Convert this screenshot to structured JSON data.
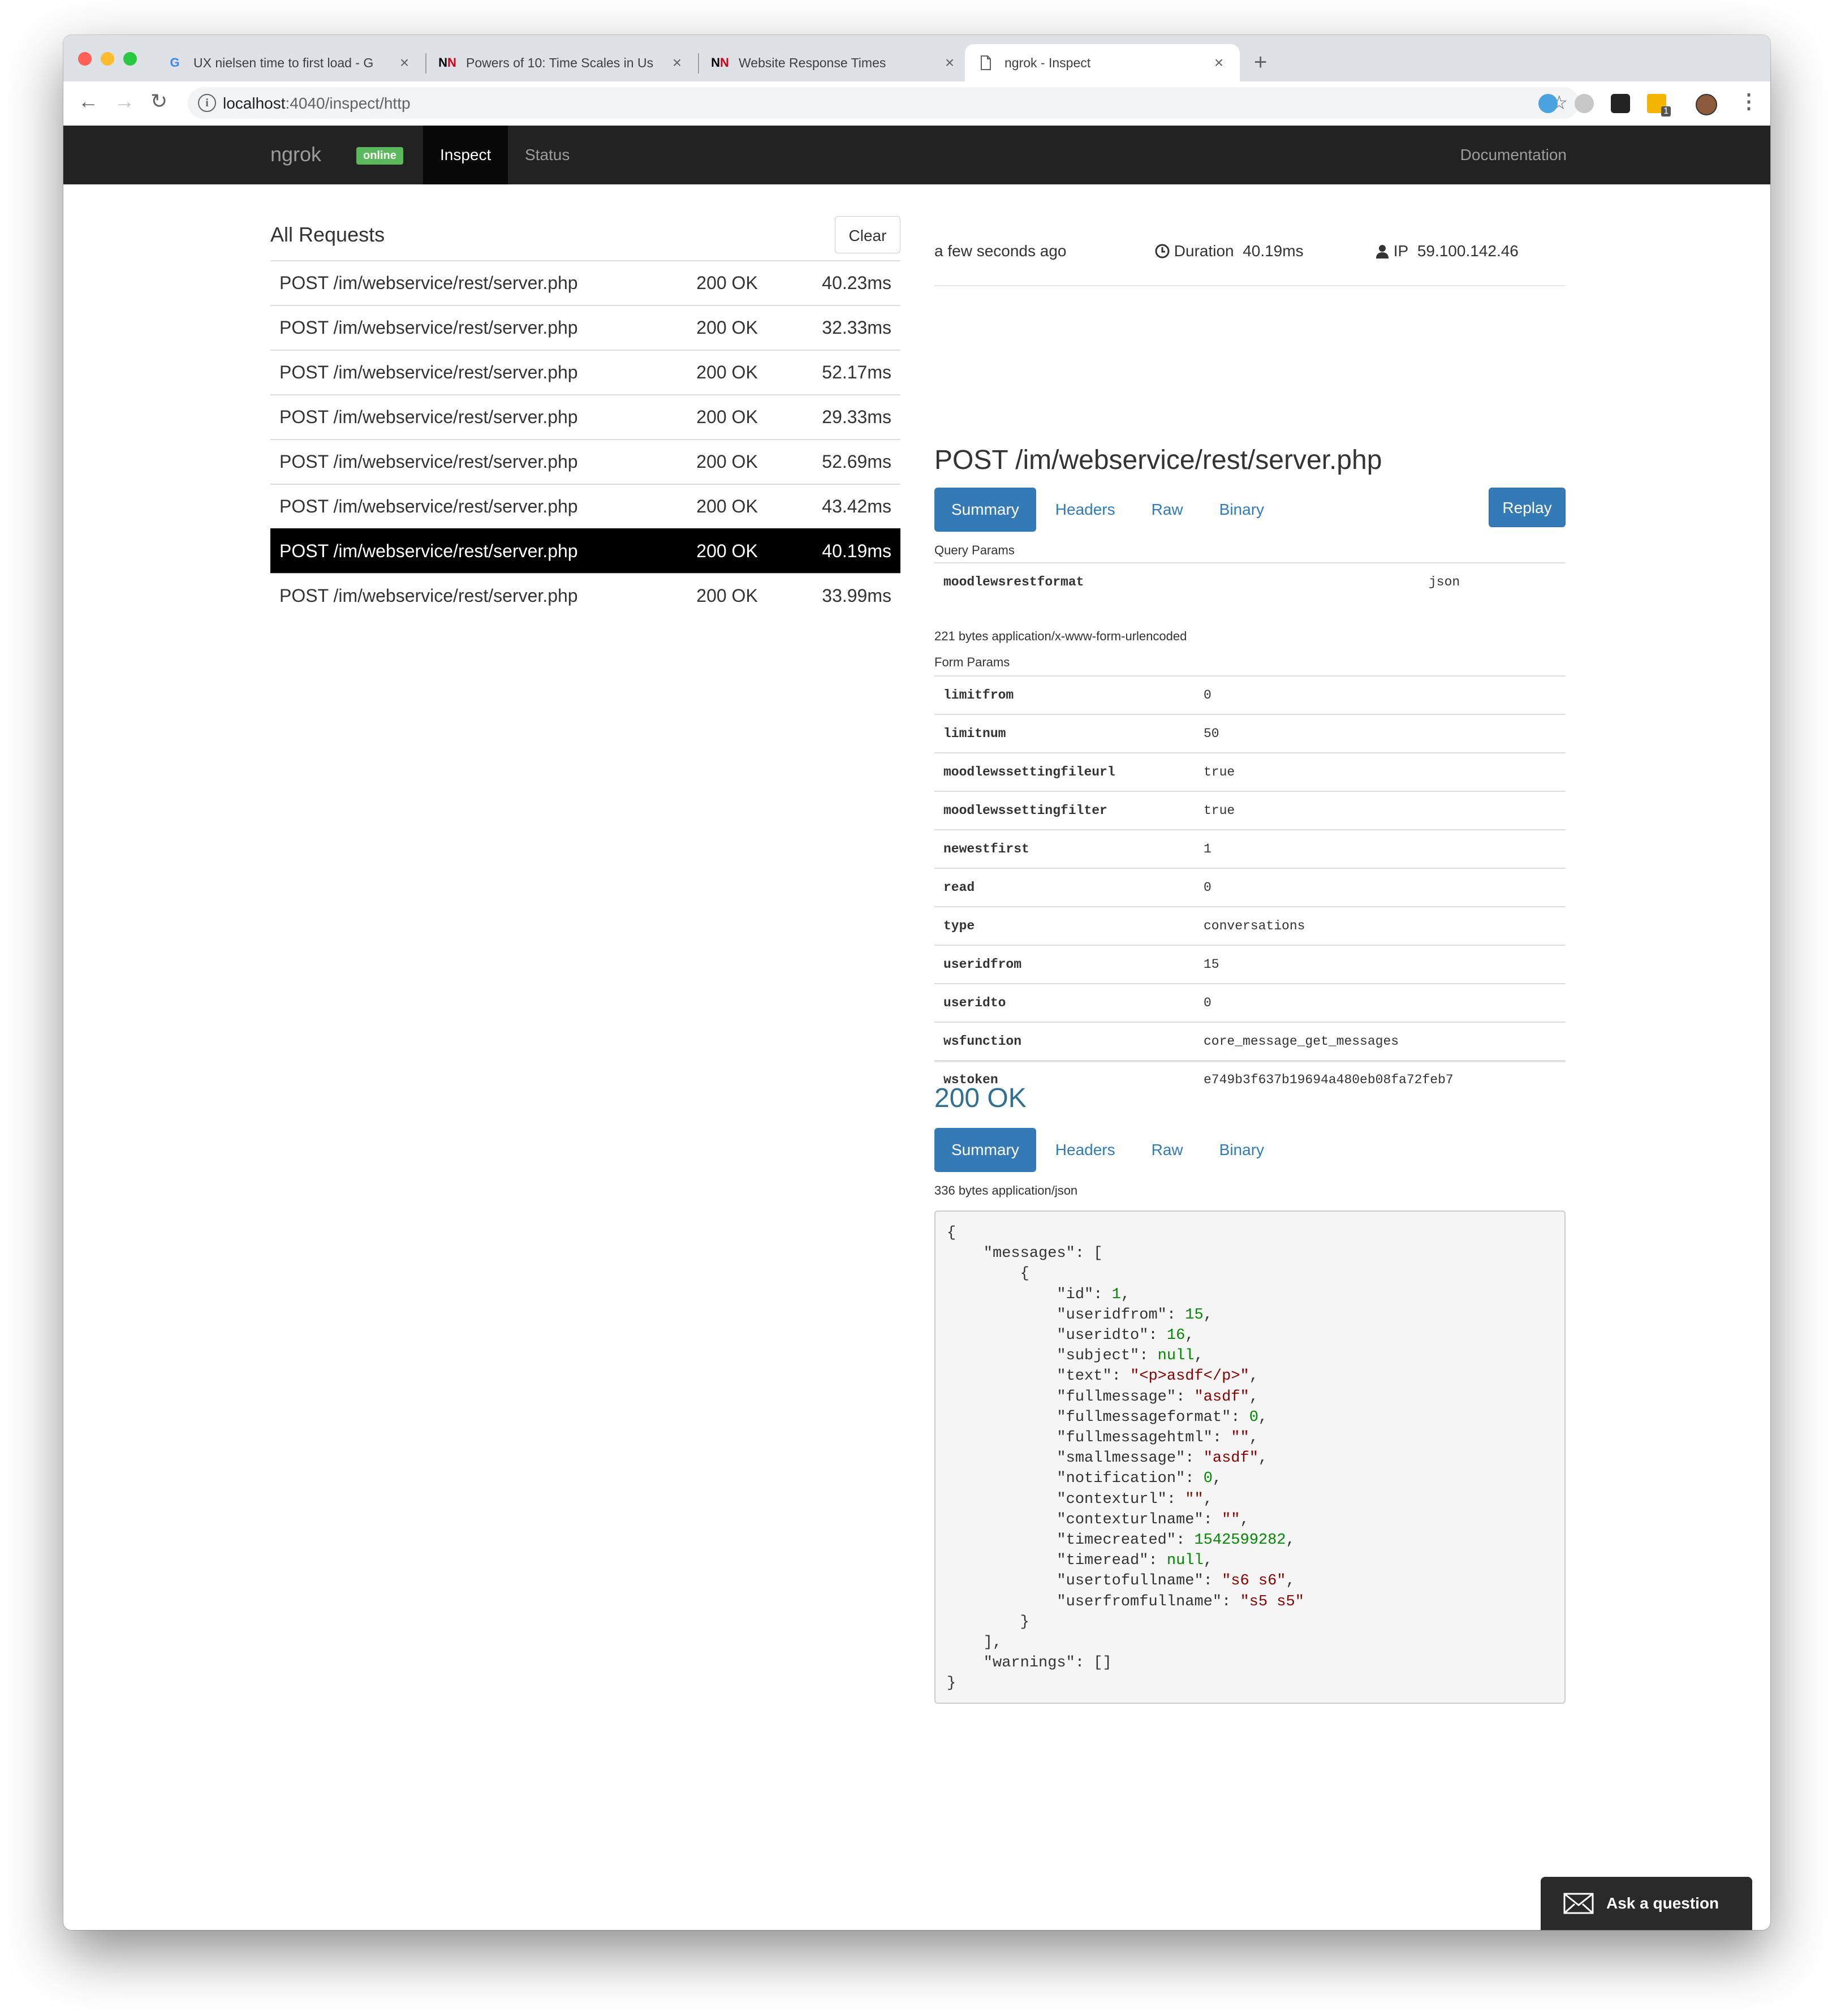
{
  "browser": {
    "tabs": [
      {
        "title": "UX nielsen time to first load - G",
        "favicon": "google-icon"
      },
      {
        "title": "Powers of 10: Time Scales in Us",
        "favicon": "nn-icon"
      },
      {
        "title": "Website Response Times",
        "favicon": "nn-icon"
      },
      {
        "title": "ngrok - Inspect",
        "favicon": "document-icon"
      }
    ],
    "url_host": "localhost",
    "url_path": ":4040/inspect/http",
    "extension_badge": "1"
  },
  "nav": {
    "brand": "ngrok",
    "status_badge": "online",
    "links": [
      "Inspect",
      "Status"
    ],
    "documentation": "Documentation"
  },
  "requests": {
    "heading": "All Requests",
    "clear_label": "Clear",
    "rows": [
      {
        "path": "POST /im/webservice/rest/server.php",
        "status": "200 OK",
        "duration": "40.23ms"
      },
      {
        "path": "POST /im/webservice/rest/server.php",
        "status": "200 OK",
        "duration": "32.33ms"
      },
      {
        "path": "POST /im/webservice/rest/server.php",
        "status": "200 OK",
        "duration": "52.17ms"
      },
      {
        "path": "POST /im/webservice/rest/server.php",
        "status": "200 OK",
        "duration": "29.33ms"
      },
      {
        "path": "POST /im/webservice/rest/server.php",
        "status": "200 OK",
        "duration": "52.69ms"
      },
      {
        "path": "POST /im/webservice/rest/server.php",
        "status": "200 OK",
        "duration": "43.42ms"
      },
      {
        "path": "POST /im/webservice/rest/server.php",
        "status": "200 OK",
        "duration": "40.19ms"
      },
      {
        "path": "POST /im/webservice/rest/server.php",
        "status": "200 OK",
        "duration": "33.99ms"
      }
    ]
  },
  "detail": {
    "time": "a few seconds ago",
    "duration_label": "Duration",
    "duration": "40.19ms",
    "ip_label": "IP",
    "ip": "59.100.142.46",
    "title": "POST /im/webservice/rest/server.php",
    "tabs": [
      "Summary",
      "Headers",
      "Raw",
      "Binary"
    ],
    "replay_label": "Replay",
    "query_params_label": "Query Params",
    "query_params": [
      {
        "key": "moodlewsrestformat",
        "value": "json"
      }
    ],
    "body_info": "221 bytes application/x-www-form-urlencoded",
    "form_params_label": "Form Params",
    "form_params": [
      {
        "key": "limitfrom",
        "value": "0"
      },
      {
        "key": "limitnum",
        "value": "50"
      },
      {
        "key": "moodlewssettingfileurl",
        "value": "true"
      },
      {
        "key": "moodlewssettingfilter",
        "value": "true"
      },
      {
        "key": "newestfirst",
        "value": "1"
      },
      {
        "key": "read",
        "value": "0"
      },
      {
        "key": "type",
        "value": "conversations"
      },
      {
        "key": "useridfrom",
        "value": "15"
      },
      {
        "key": "useridto",
        "value": "0"
      },
      {
        "key": "wsfunction",
        "value": "core_message_get_messages"
      },
      {
        "key": "wstoken",
        "value": "e749b3f637b19694a480eb08fa72feb7"
      }
    ]
  },
  "response": {
    "status": "200 OK",
    "tabs": [
      "Summary",
      "Headers",
      "Raw",
      "Binary"
    ],
    "body_info": "336 bytes application/json",
    "json_lines": [
      [
        [
          "p",
          "{"
        ]
      ],
      [
        [
          "p",
          "    \"messages\": ["
        ]
      ],
      [
        [
          "p",
          "        {"
        ]
      ],
      [
        [
          "p",
          "            \"id\": "
        ],
        [
          "n",
          "1"
        ],
        [
          "p",
          ","
        ]
      ],
      [
        [
          "p",
          "            \"useridfrom\": "
        ],
        [
          "n",
          "15"
        ],
        [
          "p",
          ","
        ]
      ],
      [
        [
          "p",
          "            \"useridto\": "
        ],
        [
          "n",
          "16"
        ],
        [
          "p",
          ","
        ]
      ],
      [
        [
          "p",
          "            \"subject\": "
        ],
        [
          "n",
          "null"
        ],
        [
          "p",
          ","
        ]
      ],
      [
        [
          "p",
          "            \"text\": "
        ],
        [
          "s",
          "\"<p>asdf</p>\""
        ],
        [
          "p",
          ","
        ]
      ],
      [
        [
          "p",
          "            \"fullmessage\": "
        ],
        [
          "s",
          "\"asdf\""
        ],
        [
          "p",
          ","
        ]
      ],
      [
        [
          "p",
          "            \"fullmessageformat\": "
        ],
        [
          "n",
          "0"
        ],
        [
          "p",
          ","
        ]
      ],
      [
        [
          "p",
          "            \"fullmessagehtml\": "
        ],
        [
          "s",
          "\"\""
        ],
        [
          "p",
          ","
        ]
      ],
      [
        [
          "p",
          "            \"smallmessage\": "
        ],
        [
          "s",
          "\"asdf\""
        ],
        [
          "p",
          ","
        ]
      ],
      [
        [
          "p",
          "            \"notification\": "
        ],
        [
          "n",
          "0"
        ],
        [
          "p",
          ","
        ]
      ],
      [
        [
          "p",
          "            \"contexturl\": "
        ],
        [
          "s",
          "\"\""
        ],
        [
          "p",
          ","
        ]
      ],
      [
        [
          "p",
          "            \"contexturlname\": "
        ],
        [
          "s",
          "\"\""
        ],
        [
          "p",
          ","
        ]
      ],
      [
        [
          "p",
          "            \"timecreated\": "
        ],
        [
          "n",
          "1542599282"
        ],
        [
          "p",
          ","
        ]
      ],
      [
        [
          "p",
          "            \"timeread\": "
        ],
        [
          "n",
          "null"
        ],
        [
          "p",
          ","
        ]
      ],
      [
        [
          "p",
          "            \"usertofullname\": "
        ],
        [
          "s",
          "\"s6 s6\""
        ],
        [
          "p",
          ","
        ]
      ],
      [
        [
          "p",
          "            \"userfromfullname\": "
        ],
        [
          "s",
          "\"s5 s5\""
        ]
      ],
      [
        [
          "p",
          "        }"
        ]
      ],
      [
        [
          "p",
          "    ],"
        ]
      ],
      [
        [
          "p",
          "    \"warnings\": []"
        ]
      ],
      [
        [
          "p",
          "}"
        ]
      ]
    ]
  },
  "help": {
    "ask_label": "Ask a question"
  }
}
